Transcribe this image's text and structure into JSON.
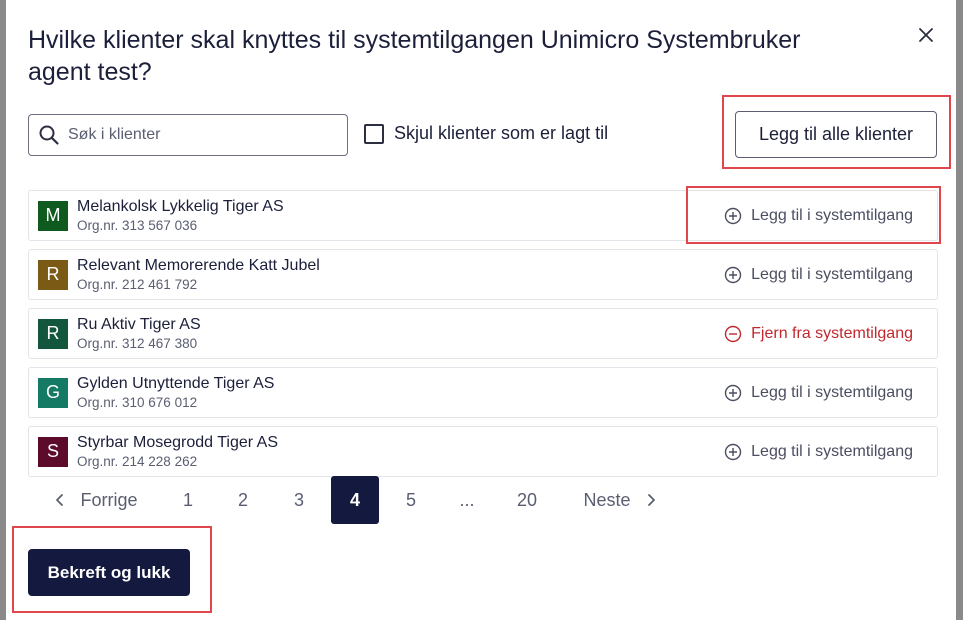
{
  "modal": {
    "title": "Hvilke klienter skal knyttes til systemtilgangen Unimicro Systembruker agent test?",
    "search_placeholder": "Søk i klienter",
    "hide_added_label": "Skjul klienter som er lagt til",
    "hide_added_checked": false,
    "add_all_label": "Legg til alle klienter"
  },
  "clients": [
    {
      "initial": "M",
      "name": "Melankolsk Lykkelig Tiger AS",
      "org": "Org.nr. 313 567 036",
      "color": "#0f5a1e",
      "action": "Legg til i systemtilgang",
      "added": false
    },
    {
      "initial": "R",
      "name": "Relevant Memorerende Katt Jubel",
      "org": "Org.nr. 212 461 792",
      "color": "#7a5a14",
      "action": "Legg til i systemtilgang",
      "added": false
    },
    {
      "initial": "R",
      "name": "Ru Aktiv Tiger AS",
      "org": "Org.nr. 312 467 380",
      "color": "#12563e",
      "action": "Fjern fra systemtilgang",
      "added": true
    },
    {
      "initial": "G",
      "name": "Gylden Utnyttende Tiger AS",
      "org": "Org.nr. 310 676 012",
      "color": "#147a63",
      "action": "Legg til i systemtilgang",
      "added": false
    },
    {
      "initial": "S",
      "name": "Styrbar Mosegrodd Tiger AS",
      "org": "Org.nr. 214 228 262",
      "color": "#5c0b2a",
      "action": "Legg til i systemtilgang",
      "added": false
    }
  ],
  "pagination": {
    "prev_label": "Forrige",
    "next_label": "Neste",
    "pages": [
      "1",
      "2",
      "3",
      "4",
      "5",
      "...",
      "20"
    ],
    "current": "4"
  },
  "footer": {
    "confirm_label": "Bekreft og lukk"
  },
  "colors": {
    "primary": "#14193f",
    "danger": "#c0282e",
    "highlight": "#e0474c"
  }
}
